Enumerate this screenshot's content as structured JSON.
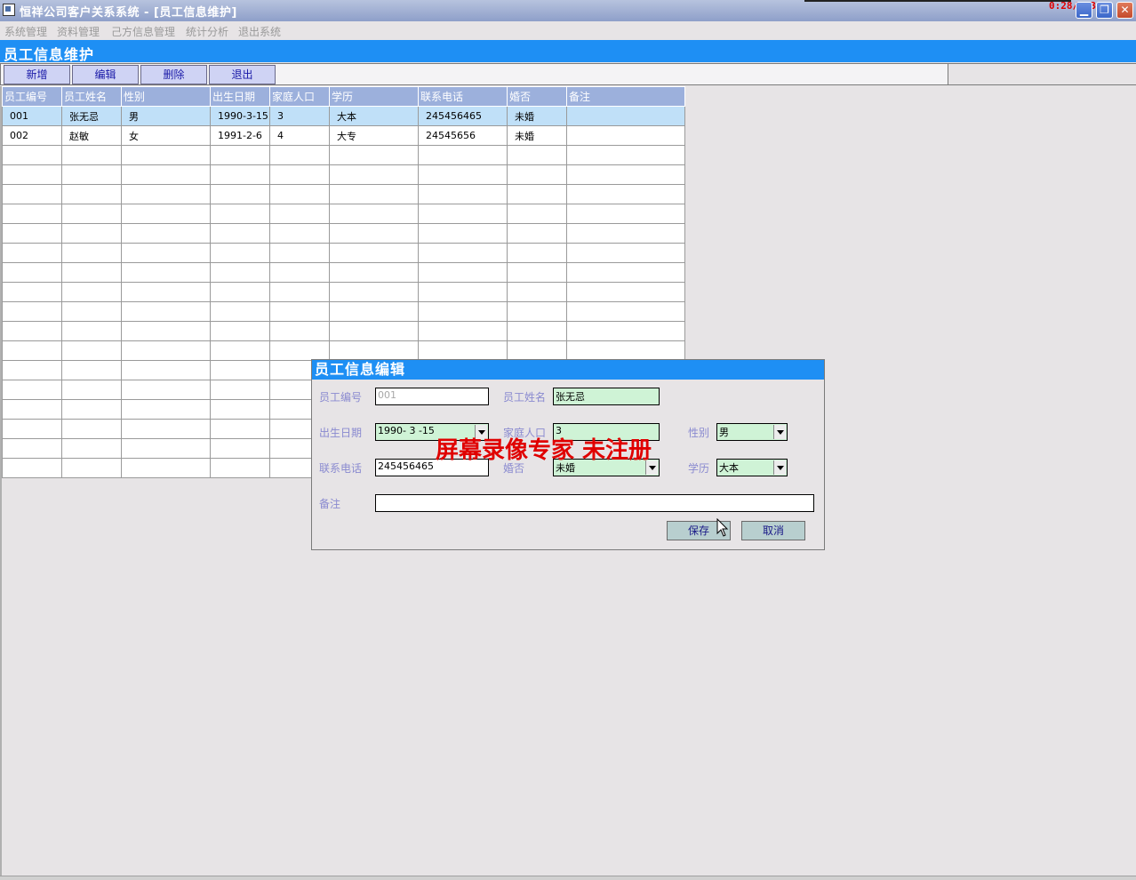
{
  "window": {
    "title": "恒祥公司客户关系系统 - [员工信息维护]",
    "timer": "0:28/1:3",
    "buttons": {
      "minimize": "▁",
      "restore": "❐",
      "close": "✕"
    }
  },
  "menu": [
    "系统管理",
    "资料管理",
    "己方信息管理",
    "统计分析",
    "退出系统"
  ],
  "form_title": "员工信息维护",
  "toolbar": {
    "add": "新增",
    "edit": "编辑",
    "delete": "删除",
    "exit": "退出"
  },
  "grid": {
    "columns": [
      "员工编号",
      "员工姓名",
      "性别",
      "出生日期",
      "家庭人口",
      "学历",
      "联系电话",
      "婚否",
      "备注"
    ],
    "rows": [
      [
        "001",
        "张无忌",
        "男",
        "1990-3-15",
        "3",
        "大本",
        "245456465",
        "未婚",
        ""
      ],
      [
        "002",
        "赵敏",
        "女",
        "1991-2-6",
        "4",
        "大专",
        "24545656",
        "未婚",
        ""
      ]
    ],
    "empty_rows": 17
  },
  "dialog": {
    "title": "员工信息编辑",
    "labels": {
      "emp_id": "员工编号",
      "emp_name": "员工姓名",
      "birth": "出生日期",
      "family": "家庭人口",
      "gender": "性别",
      "phone": "联系电话",
      "married": "婚否",
      "education": "学历",
      "remark": "备注"
    },
    "values": {
      "emp_id": "001",
      "emp_name": "张无忌",
      "birth": "1990- 3 -15",
      "family": "3",
      "gender": "男",
      "phone": "245456465",
      "married": "未婚",
      "education": "大本",
      "remark": ""
    },
    "buttons": {
      "save": "保存",
      "cancel": "取消"
    }
  },
  "watermark": "屏幕录像专家  未注册",
  "colors": {
    "header_blue": "#1e8ff4",
    "grid_header": "#9cb0dc",
    "selected_row": "#c0e0f8",
    "field_green": "#cff3d6"
  }
}
